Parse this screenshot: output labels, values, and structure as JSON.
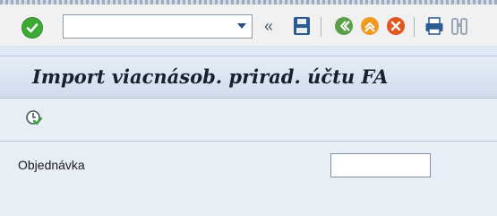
{
  "toolbar": {
    "command_value": "",
    "icons": [
      "check-icon",
      "dropdown-icon",
      "double-left-chevron-icon",
      "save-icon",
      "back-icon",
      "exit-icon",
      "cancel-icon",
      "print-icon",
      "find-icon"
    ]
  },
  "screen": {
    "title": "Import viacnásob. prirad. účtu FA",
    "execute_icon": "execute-icon"
  },
  "form": {
    "order_label": "Objednávka",
    "order_value": ""
  },
  "colors": {
    "title_bg": "#d6e2ef",
    "toolbar_bg": "#f1f1f1",
    "content_bg": "#e8eef5",
    "ok_green": "#3daa35",
    "back_green": "#5aa04a",
    "exit_orange": "#f29a20",
    "cancel_orange": "#e2571e"
  }
}
